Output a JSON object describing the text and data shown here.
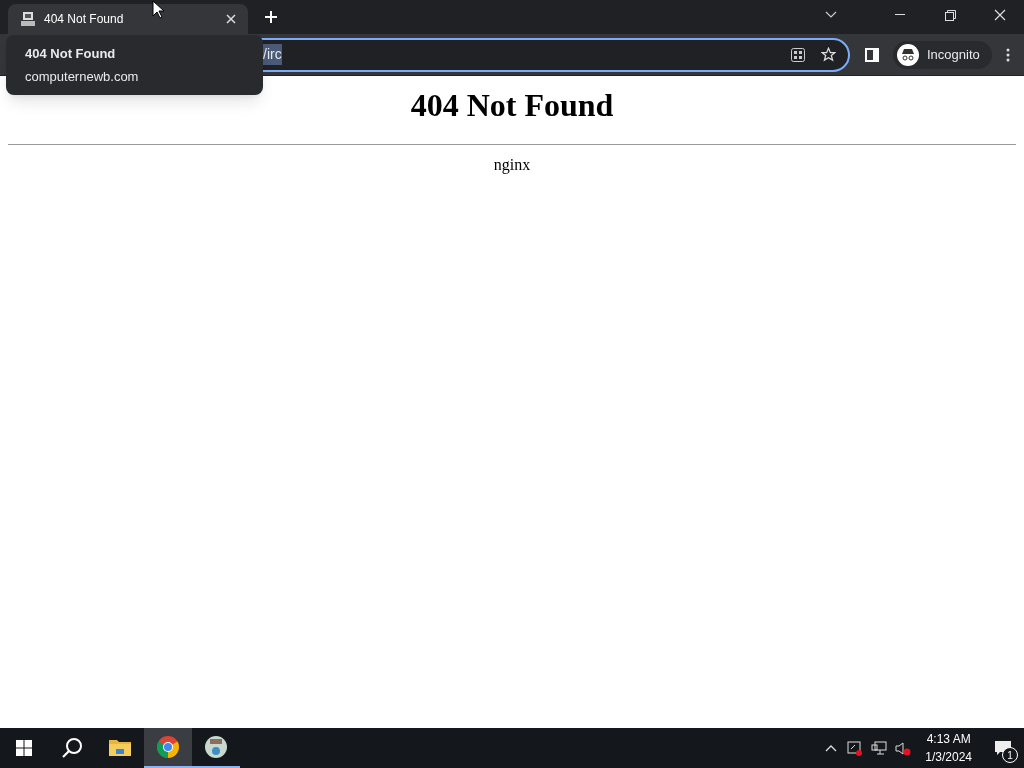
{
  "browser": {
    "tab": {
      "title": "404 Not Found",
      "selected": true
    },
    "tooltip": {
      "title": "404 Not Found",
      "domain": "computernewb.com"
    },
    "address": {
      "value": "/irc",
      "selected": true
    },
    "profile": "Incognito"
  },
  "page": {
    "heading": "404 Not Found",
    "server": "nginx"
  },
  "taskbar": {
    "apps": [
      {
        "kind": "explorer",
        "active": false,
        "running": false
      },
      {
        "kind": "chrome",
        "active": true,
        "running": true
      },
      {
        "kind": "app",
        "active": false,
        "running": true
      }
    ],
    "time": "4:13 AM",
    "date": "1/3/2024",
    "notifications": "1"
  }
}
